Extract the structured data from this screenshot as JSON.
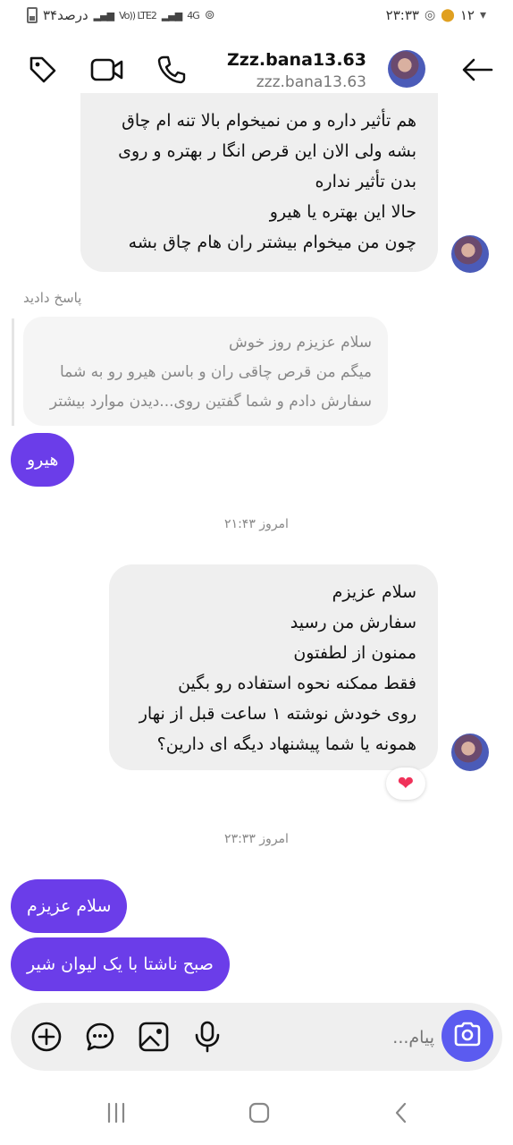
{
  "status_bar": {
    "time": "۲۳:۳۳",
    "notif_count": "۱۲",
    "battery_text": "۳۴درصد",
    "network": "4G",
    "volte": "Vo)) LTE2"
  },
  "header": {
    "title": "Zzz.bana13.63",
    "subtitle": "zzz.bana13.63"
  },
  "messages": {
    "m1": {
      "lines": [
        "هم تأثیر داره و من نمیخوام بالا تنه ام چاق",
        "بشه ولی الان این قرص انگا ر بهتره و روی",
        "بدن تأثیر نداره",
        "حالا این بهتره یا هیرو",
        "چون من میخوام بیشتر ران هام چاق بشه"
      ]
    },
    "reply": {
      "label": "پاسخ دادید",
      "quote_lines": [
        "سلام عزیزم روز خوش",
        "میگم من قرص چاقی ران و باسن هیرو رو به شما",
        "سفارش دادم و شما گفتین روی...دیدن موارد بیشتر"
      ],
      "text": "هیرو"
    },
    "ts1": "امروز ۲۱:۴۳",
    "m2": {
      "lines": [
        "سلام عزیزم",
        "سفارش من رسید",
        "ممنون از لطفتون",
        "فقط ممکنه نحوه استفاده رو بگین",
        "روی خودش نوشته ۱ ساعت قبل از نهار",
        "همونه یا شما پیشنهاد دیگه ای دارین؟"
      ],
      "reaction": "❤"
    },
    "ts2": "امروز ۲۳:۳۳",
    "out1": "سلام عزیزم",
    "out2": "صبح ناشتا با یک لیوان شیر"
  },
  "composer": {
    "placeholder": "پیام..."
  },
  "colors": {
    "outgoing": "#6b3de9",
    "incoming": "#efefef",
    "camera": "#5b5bf0"
  }
}
